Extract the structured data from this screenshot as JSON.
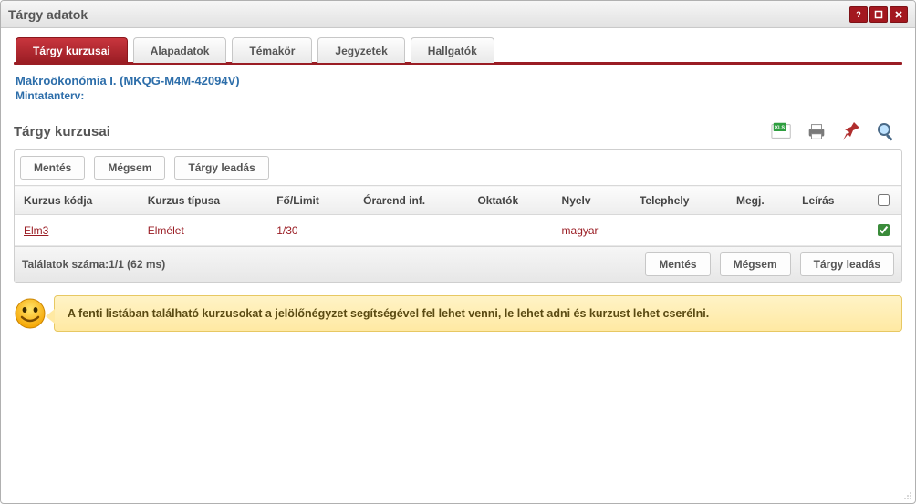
{
  "window": {
    "title": "Tárgy adatok"
  },
  "tabs": [
    {
      "label": "Tárgy kurzusai",
      "active": true
    },
    {
      "label": "Alapadatok",
      "active": false
    },
    {
      "label": "Témakör",
      "active": false
    },
    {
      "label": "Jegyzetek",
      "active": false
    },
    {
      "label": "Hallgatók",
      "active": false
    }
  ],
  "subject": {
    "name_link": "Makroökonómia I. (MKQG-M4M-42094V)",
    "curriculum_label": "Mintatanterv:"
  },
  "section_title": "Tárgy kurzusai",
  "buttons": {
    "save": "Mentés",
    "cancel": "Mégsem",
    "drop": "Tárgy leadás"
  },
  "columns": {
    "code": "Kurzus kódja",
    "type": "Kurzus típusa",
    "limit": "Fő/Limit",
    "timetable": "Órarend inf.",
    "teachers": "Oktatók",
    "language": "Nyelv",
    "site": "Telephely",
    "note": "Megj.",
    "desc": "Leírás"
  },
  "rows": [
    {
      "code": "Elm3",
      "type": "Elmélet",
      "limit": "1/30",
      "timetable": "",
      "teachers": "",
      "language": "magyar",
      "site": "",
      "note": "",
      "desc": "",
      "checked": true
    }
  ],
  "result_count": "Találatok száma:1/1 (62 ms)",
  "tip": "A fenti listában található kurzusokat a jelölőnégyzet segítségével fel lehet venni, le lehet adni és kurzust lehet cserélni.",
  "icons": {
    "xls": "xls-icon",
    "print": "print-icon",
    "pin": "pin-icon",
    "search": "search-icon"
  }
}
